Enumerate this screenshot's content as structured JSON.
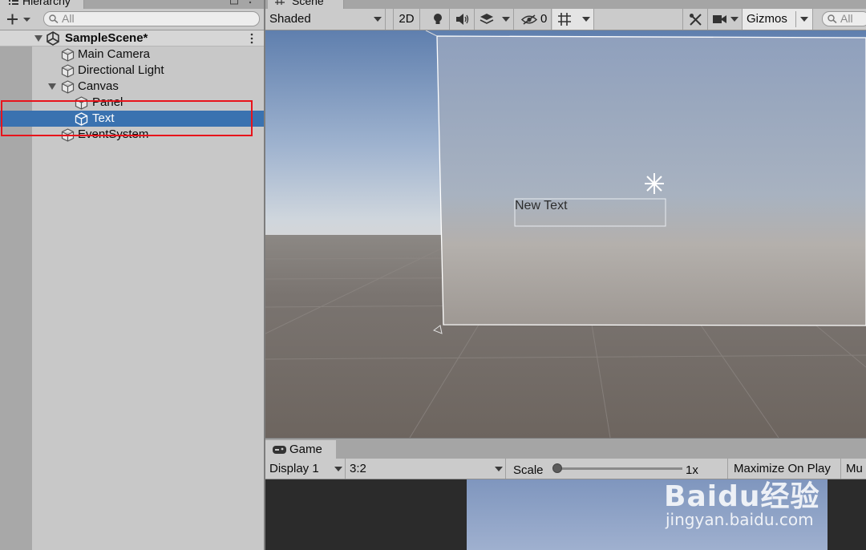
{
  "hierarchy": {
    "tab_label": "Hierarchy",
    "search_placeholder": "All",
    "scene_name": "SampleScene*",
    "items": [
      {
        "label": "Main Camera"
      },
      {
        "label": "Directional Light"
      },
      {
        "label": "Canvas"
      },
      {
        "label": "Panel"
      },
      {
        "label": "Text",
        "selected": true
      },
      {
        "label": "EventSystem"
      }
    ]
  },
  "scene": {
    "tab_label": "Scene",
    "shading_mode": "Shaded",
    "mode_2d": "2D",
    "hidden_count": "0",
    "gizmos_label": "Gizmos",
    "search_placeholder": "All",
    "canvas_text": "New Text"
  },
  "game": {
    "tab_label": "Game",
    "display": "Display 1",
    "aspect": "3:2",
    "scale_label": "Scale",
    "scale_value": "1x",
    "maximize_label": "Maximize On Play",
    "mute_label": "Mu"
  },
  "watermark": {
    "brand": "Baidu经验",
    "url": "jingyan.baidu.com"
  },
  "colors": {
    "selection": "#3a72b0",
    "highlight_box": "#e8141b"
  }
}
